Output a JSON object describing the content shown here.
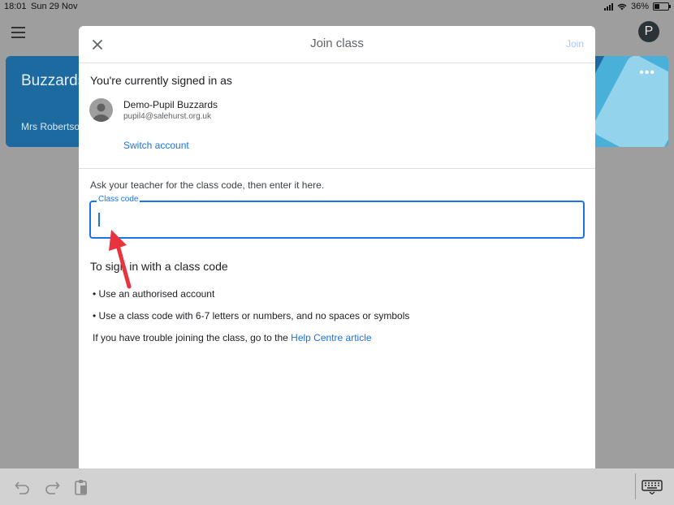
{
  "status_bar": {
    "time": "18:01",
    "date": "Sun 29 Nov",
    "battery_percent": "36%",
    "battery_level": 0.36
  },
  "background": {
    "menu_icon": "menu-icon",
    "avatar_letter": "P",
    "class_card": {
      "title": "Buzzards",
      "teacher": "Mrs Robertson",
      "more_icon": "more-horizontal-icon",
      "color": "#1d6aa0"
    }
  },
  "modal": {
    "title": "Join class",
    "close_icon": "close-icon",
    "join_label": "Join",
    "signed_in_label": "You're currently signed in as",
    "user_name": "Demo-Pupil Buzzards",
    "user_email": "pupil4@salehurst.org.uk",
    "switch_account_label": "Switch account",
    "instructions": "Ask your teacher for the class code, then enter it here.",
    "class_code_label": "Class code",
    "class_code_value": "",
    "howto_title": "To sign in with a class code",
    "bullets": [
      "• Use an authorised account",
      "• Use a class code with 6-7 letters or numbers, and no spaces or symbols"
    ],
    "help_prefix": "If you have trouble joining the class, go to the ",
    "help_link": "Help Centre article"
  },
  "toolbar": {
    "undo_icon": "undo-icon",
    "redo_icon": "redo-icon",
    "paste_icon": "clipboard-icon",
    "keyboard_icon": "keyboard-icon"
  },
  "colors": {
    "accent": "#1a73e8",
    "annotation_arrow": "#e8343f"
  }
}
